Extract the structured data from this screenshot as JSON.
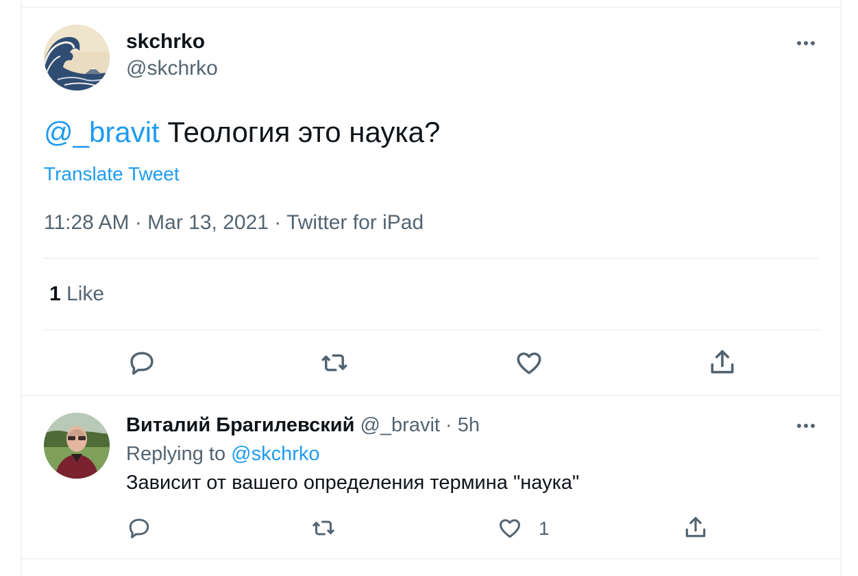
{
  "main_tweet": {
    "display_name": "skchrko",
    "handle": "@skchrko",
    "mention": "@_bravit",
    "text": " Теология это наука?",
    "translate_label": "Translate Tweet",
    "timestamp": "11:28 AM · Mar 13, 2021 · Twitter for iPad",
    "likes_count": "1",
    "likes_label": " Like"
  },
  "reply": {
    "display_name": "Виталий Брагилевский",
    "handle": "@_bravit",
    "separator": " · ",
    "time": "5h",
    "replying_label": "Replying to ",
    "replying_to": "@skchrko",
    "text": "Зависит от вашего определения термина \"наука\"",
    "like_count": "1"
  },
  "colors": {
    "link": "#1d9bf0",
    "secondary_text": "#536471",
    "primary_text": "#0f1419",
    "divider": "#eff3f4"
  },
  "icons": [
    "more-icon",
    "reply-icon",
    "retweet-icon",
    "like-icon",
    "share-icon"
  ]
}
